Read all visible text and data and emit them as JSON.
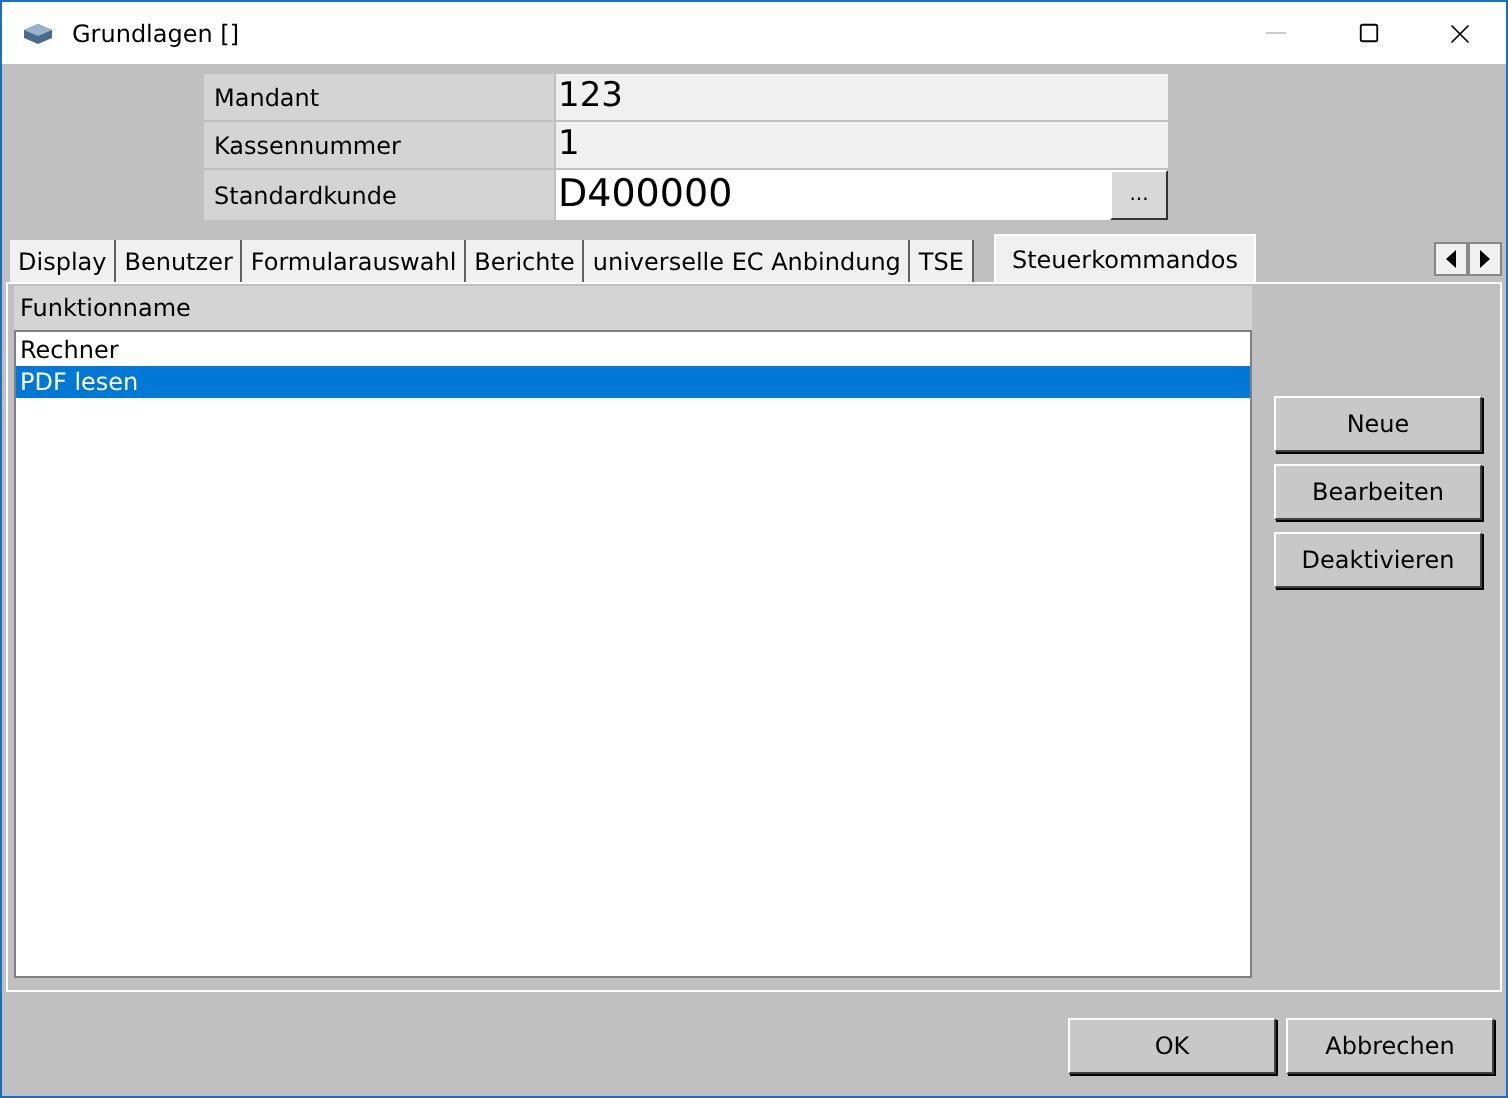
{
  "window": {
    "title": "Grundlagen []"
  },
  "fields": [
    {
      "label": "Mandant",
      "value": "123",
      "kind": "readonly"
    },
    {
      "label": "Kassennummer",
      "value": "1",
      "kind": "readonly"
    },
    {
      "label": "Standardkunde",
      "value": "D400000",
      "kind": "lookup",
      "button": "..."
    }
  ],
  "tabs": [
    {
      "label": "Display",
      "selected": false
    },
    {
      "label": "Benutzer",
      "selected": false
    },
    {
      "label": "Formularauswahl",
      "selected": false
    },
    {
      "label": "Berichte",
      "selected": false
    },
    {
      "label": "universelle EC Anbindung",
      "selected": false
    },
    {
      "label": "TSE",
      "selected": false
    },
    {
      "label": "Steuerkommandos",
      "selected": true
    }
  ],
  "list": {
    "header": "Funktionname",
    "items": [
      {
        "label": "Rechner",
        "selected": false
      },
      {
        "label": "PDF lesen",
        "selected": true
      }
    ]
  },
  "side_buttons": [
    "Neue",
    "Bearbeiten",
    "Deaktivieren"
  ],
  "buttons": [
    "OK",
    "Abbrechen"
  ]
}
